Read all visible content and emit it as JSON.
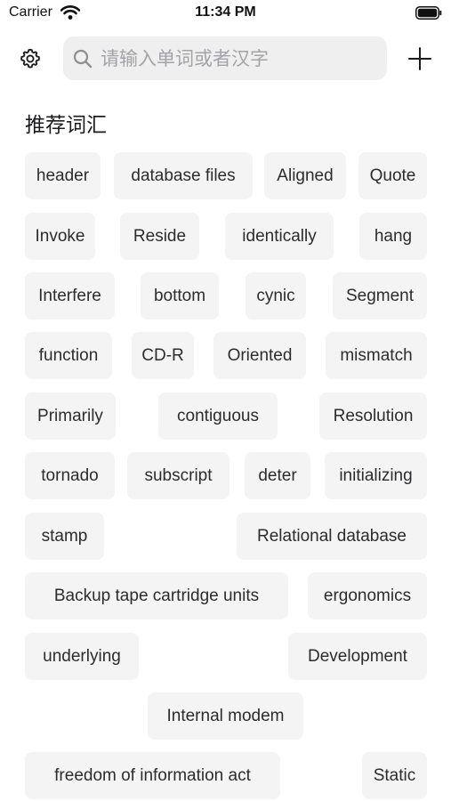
{
  "status_bar": {
    "carrier": "Carrier",
    "time": "11:34 PM",
    "icons": [
      "wifi-icon",
      "battery-icon"
    ]
  },
  "header": {
    "settings_icon": "gear-icon",
    "search_placeholder": "请输入单词或者汉字",
    "search_value": "",
    "add_icon": "plus-icon"
  },
  "section": {
    "title": "推荐词汇"
  },
  "tags": [
    "header",
    "database files",
    "Aligned",
    "Quote",
    "Invoke",
    "Reside",
    "identically",
    "hang",
    "Interfere",
    "bottom",
    "cynic",
    "Segment",
    "function",
    "CD-R",
    "Oriented",
    "mismatch",
    "Primarily",
    "contiguous",
    "Resolution",
    "tornado",
    "subscript",
    "deter",
    "initializing",
    "stamp",
    "Relational database",
    "Backup tape cartridge units",
    "ergonomics",
    "underlying",
    "Development",
    "Internal modem",
    "freedom of information act",
    "Static"
  ],
  "colors": {
    "tag_background": "#f4f4f5",
    "search_background": "#efefef",
    "placeholder": "#a3a3a8",
    "text": "#1c1c1e"
  }
}
